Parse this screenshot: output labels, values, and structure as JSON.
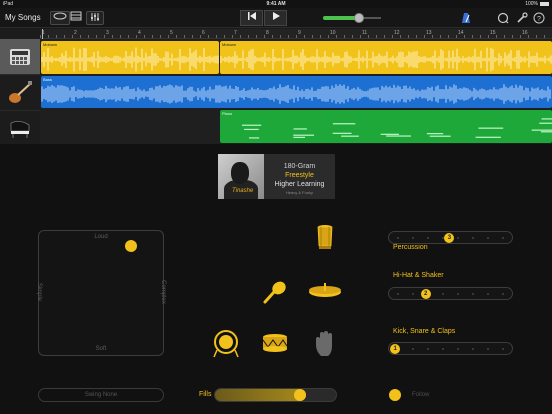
{
  "status_bar": {
    "device": "iPad",
    "time": "9:41 AM",
    "battery": "100%"
  },
  "toolbar": {
    "my_songs": "My Songs",
    "rewind_icon": "skip-back-icon",
    "play_icon": "play-icon",
    "volume_level": 0.62,
    "accent_color": "#4ec24e"
  },
  "tracks": [
    {
      "name": "Drum Machine",
      "icon": "drum-machine-icon",
      "active": true
    },
    {
      "name": "Bass",
      "icon": "bass-guitar-icon",
      "active": false
    },
    {
      "name": "Piano",
      "icon": "piano-icon",
      "active": false
    }
  ],
  "ruler": {
    "marks": [
      "1",
      "2",
      "3",
      "4",
      "5",
      "6",
      "7",
      "8",
      "9",
      "10",
      "11",
      "12",
      "13",
      "14",
      "15",
      "16"
    ]
  },
  "regions": {
    "drums_a": "Motown",
    "drums_b": "Motown",
    "bass": "Bass",
    "piano": "Piano"
  },
  "artwork": {
    "line1": "180-Gram",
    "line2": "Freestyle",
    "line3": "Higher Learning",
    "line4": "Heavy & Funky",
    "signature": "Tinashe"
  },
  "xy_pad": {
    "top": "Loud",
    "bottom": "Soft",
    "left": "Simple",
    "right": "Complex",
    "puck_x": 0.74,
    "puck_y": 0.12
  },
  "drum_pieces": [
    {
      "name": "conga",
      "icon": "conga-icon"
    },
    {
      "name": "shaker",
      "icon": "shaker-icon"
    },
    {
      "name": "cymbal",
      "icon": "cymbal-icon"
    },
    {
      "name": "kick",
      "icon": "kick-drum-icon"
    },
    {
      "name": "snare",
      "icon": "snare-drum-icon"
    },
    {
      "name": "clap",
      "icon": "hand-clap-icon"
    }
  ],
  "sections": [
    {
      "label": "Percussion",
      "pattern": "3",
      "position": 0.49
    },
    {
      "label": "Hi-Hat & Shaker",
      "pattern": "2",
      "position": 0.28
    },
    {
      "label": "Kick, Snare & Claps",
      "pattern": "1",
      "position": 0.01
    }
  ],
  "bottom": {
    "swing": "Swing None",
    "fills": "Fills",
    "fills_value": 0.7,
    "follow": "Follow"
  },
  "colors": {
    "drums": "#f0c21a",
    "bass": "#1e6fd2",
    "piano": "#1fa83a",
    "accent": "#f2c21a"
  }
}
